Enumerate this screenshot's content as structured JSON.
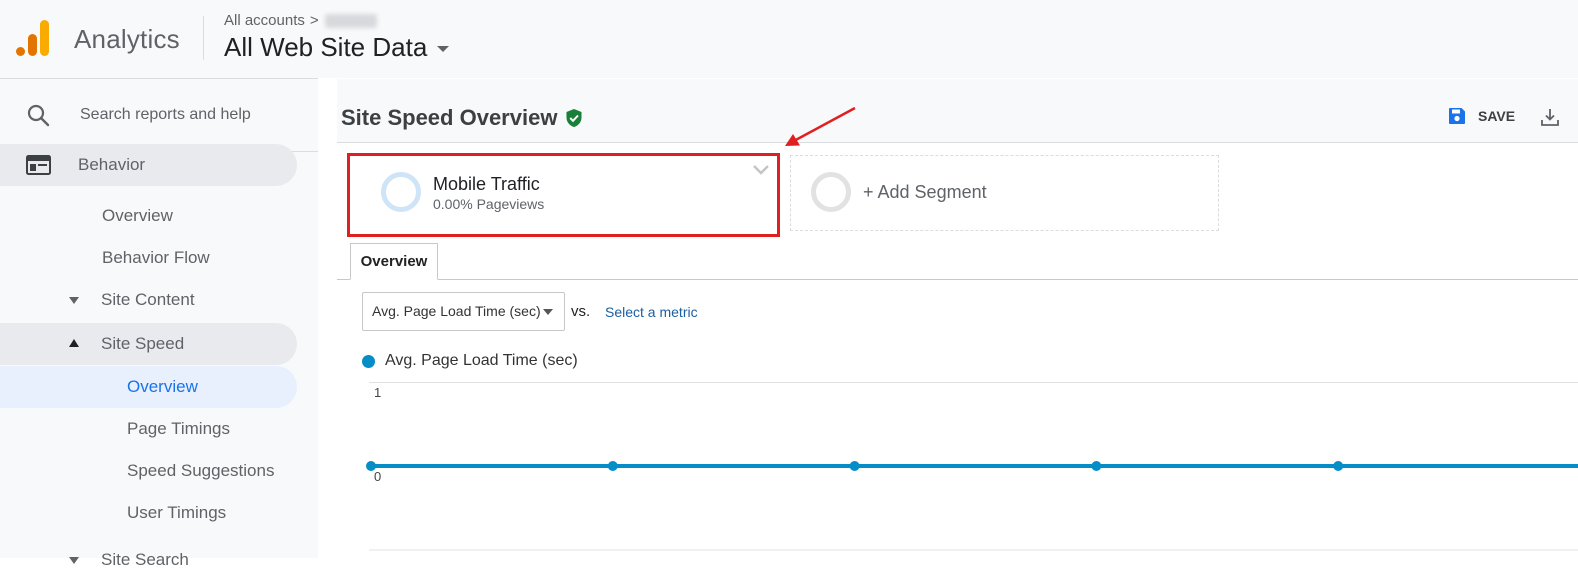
{
  "header": {
    "app_name": "Analytics",
    "breadcrumb_root": "All accounts",
    "breadcrumb_separator": ">",
    "view_name": "All Web Site Data"
  },
  "sidebar": {
    "search_placeholder": "Search reports and help",
    "items": [
      {
        "label": "Behavior"
      },
      {
        "label": "Overview"
      },
      {
        "label": "Behavior Flow"
      },
      {
        "label": "Site Content"
      },
      {
        "label": "Site Speed"
      },
      {
        "label": "Overview"
      },
      {
        "label": "Page Timings"
      },
      {
        "label": "Speed Suggestions"
      },
      {
        "label": "User Timings"
      },
      {
        "label": "Site Search"
      }
    ]
  },
  "page": {
    "title": "Site Speed Overview",
    "save_label": "SAVE"
  },
  "segments": {
    "active": {
      "name": "Mobile Traffic",
      "subtitle": "0.00% Pageviews"
    },
    "add_label": "+ Add Segment"
  },
  "tabs": [
    {
      "label": "Overview"
    }
  ],
  "controls": {
    "metric_select": "Avg. Page Load Time (sec)",
    "vs_label": "vs.",
    "select_metric_link": "Select a metric"
  },
  "colors": {
    "accent_blue": "#1a73e8",
    "series_blue": "#058dc7",
    "highlight_red": "#e02020",
    "shield_green": "#188038"
  },
  "chart_data": {
    "type": "line",
    "series": [
      {
        "name": "Avg. Page Load Time (sec)",
        "values": [
          0,
          0,
          0,
          0,
          0,
          0
        ]
      }
    ],
    "yticks": [
      "1",
      "0"
    ],
    "ylim": [
      0,
      1
    ],
    "grid": true
  }
}
